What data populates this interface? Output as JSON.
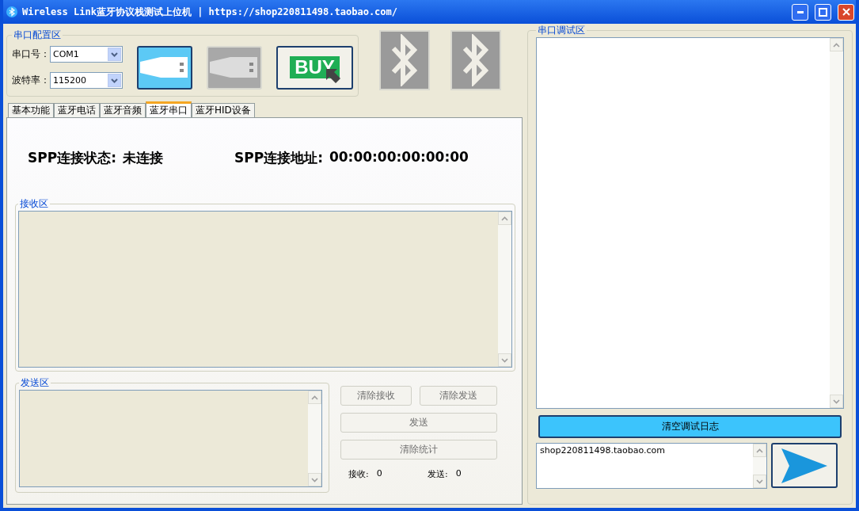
{
  "window": {
    "title": "Wireless Link蓝牙协议栈测试上位机 | https://shop220811498.taobao.com/"
  },
  "config": {
    "title": "串口配置区",
    "port_label": "串口号：",
    "port_value": "COM1",
    "baud_label": "波特率：",
    "baud_value": "115200",
    "usb_buttons": [
      {
        "disabled": false
      },
      {
        "disabled": true
      }
    ],
    "buy_label": "BUY"
  },
  "tabs": [
    {
      "label": "基本功能",
      "selected": false
    },
    {
      "label": "蓝牙电话",
      "selected": false
    },
    {
      "label": "蓝牙音频",
      "selected": false
    },
    {
      "label": "蓝牙串口",
      "selected": true
    },
    {
      "label": "蓝牙HID设备",
      "selected": false
    }
  ],
  "spp": {
    "status_label": "SPP连接状态:",
    "status_value": "未连接",
    "address_label": "SPP连接地址:",
    "address_value": "00:00:00:00:00:00"
  },
  "receive": {
    "title": "接收区"
  },
  "send": {
    "title": "发送区"
  },
  "buttons": [
    {
      "label": "清除接收",
      "disabled": true
    },
    {
      "label": "清除发送",
      "disabled": true
    },
    {
      "label": "发送",
      "disabled": true
    },
    {
      "label": "清除统计",
      "disabled": true
    }
  ],
  "counters": [
    {
      "label": "接收:",
      "value": "0"
    },
    {
      "label": "发送:",
      "value": "0"
    }
  ],
  "debug": {
    "title": "串口调试区",
    "clear_button": "清空调试日志",
    "input_value": "shop220811498.taobao.com"
  }
}
